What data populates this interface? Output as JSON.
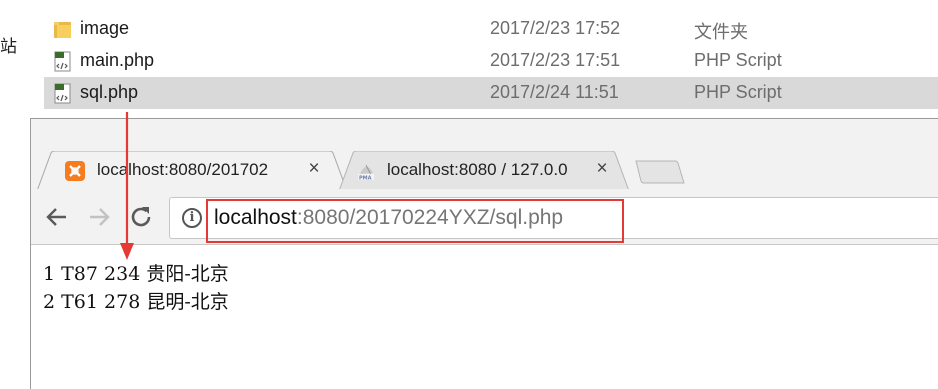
{
  "explorer": {
    "left_stub": "站",
    "files": [
      {
        "name": "image",
        "date": "2017/2/23 17:52",
        "type": "文件夹",
        "icon": "folder-icon",
        "selected": false
      },
      {
        "name": "main.php",
        "date": "2017/2/23 17:51",
        "type": "PHP Script",
        "icon": "php-file-icon",
        "selected": false
      },
      {
        "name": "sql.php",
        "date": "2017/2/24 11:51",
        "type": "PHP Script",
        "icon": "php-file-icon",
        "selected": true
      }
    ]
  },
  "browser": {
    "tabs": [
      {
        "title": "localhost:8080/201702",
        "close": "×",
        "icon": "xampp-icon",
        "active": true
      },
      {
        "title": "localhost:8080 / 127.0.0",
        "close": "×",
        "icon": "phpmyadmin-icon",
        "active": false
      }
    ],
    "nav": {
      "back": "←",
      "forward": "→",
      "reload": "⟳"
    },
    "omnibox": {
      "info": "i",
      "host": "localhost",
      "rest": ":8080/20170224YXZ/sql.php"
    },
    "content_lines": [
      "1 T87 234 贵阳-北京",
      "2 T61 278 昆明-北京"
    ]
  },
  "colors": {
    "annotation": "#e53935",
    "selected_row": "#d9d9d9",
    "tab_strip": "#f2f2f2"
  }
}
